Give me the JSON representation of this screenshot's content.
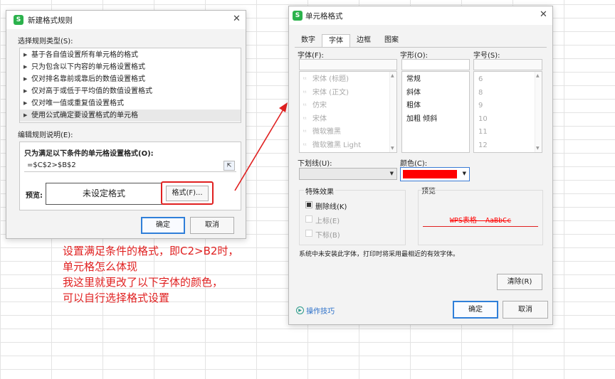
{
  "left_dialog": {
    "title": "新建格式规则",
    "rule_type_label": "选择规则类型(S):",
    "rule_types": [
      {
        "label": "基于各自值设置所有单元格的格式",
        "selected": false
      },
      {
        "label": "只为包含以下内容的单元格设置格式",
        "selected": false
      },
      {
        "label": "仅对排名靠前或靠后的数值设置格式",
        "selected": false
      },
      {
        "label": "仅对高于或低于平均值的数值设置格式",
        "selected": false
      },
      {
        "label": "仅对唯一值或重复值设置格式",
        "selected": false
      },
      {
        "label": "使用公式确定要设置格式的单元格",
        "selected": true
      }
    ],
    "edit_desc_label": "编辑规则说明(E):",
    "formula_label": "只为满足以下条件的单元格设置格式(O):",
    "formula_value": "=$C$2>$B$2",
    "preview_label": "预览:",
    "preview_text": "未设定格式",
    "format_button": "格式(F)...",
    "ok_button": "确定",
    "cancel_button": "取消"
  },
  "annotation": {
    "color": "#e02020",
    "lines": [
      "设置满足条件的格式，即C2>B2时，",
      "单元格怎么体现",
      "我这里就更改了以下字体的颜色，",
      "可以自行选择格式设置"
    ]
  },
  "right_dialog": {
    "title": "单元格格式",
    "tabs": [
      {
        "label": "数字",
        "active": false
      },
      {
        "label": "字体",
        "active": true
      },
      {
        "label": "边框",
        "active": false
      },
      {
        "label": "图案",
        "active": false
      }
    ],
    "font_label": "字体(F):",
    "style_label": "字形(O):",
    "size_label": "字号(S):",
    "fonts": [
      "宋体 (标题)",
      "宋体 (正文)",
      "仿宋",
      "宋体",
      "微软雅黑",
      "微软雅黑 Light"
    ],
    "styles": [
      "常规",
      "斜体",
      "粗体",
      "加粗 倾斜"
    ],
    "sizes": [
      "6",
      "8",
      "9",
      "10",
      "11",
      "12"
    ],
    "underline_label": "下划线(U):",
    "color_label": "颜色(C):",
    "color_value": "#ff0000",
    "effects_label": "特殊效果",
    "effects": [
      {
        "label": "删除线(K)",
        "checked": true,
        "enabled": true
      },
      {
        "label": "上标(E)",
        "checked": false,
        "enabled": false
      },
      {
        "label": "下标(B)",
        "checked": false,
        "enabled": false
      }
    ],
    "preview_group_label": "预览",
    "preview_sample": "WPS表格  AaBbCc",
    "note": "系统中未安装此字体，打印时将采用最相近的有效字体。",
    "clear_button": "清除(R)",
    "tips_link": "操作技巧",
    "ok_button": "确定",
    "cancel_button": "取消"
  }
}
